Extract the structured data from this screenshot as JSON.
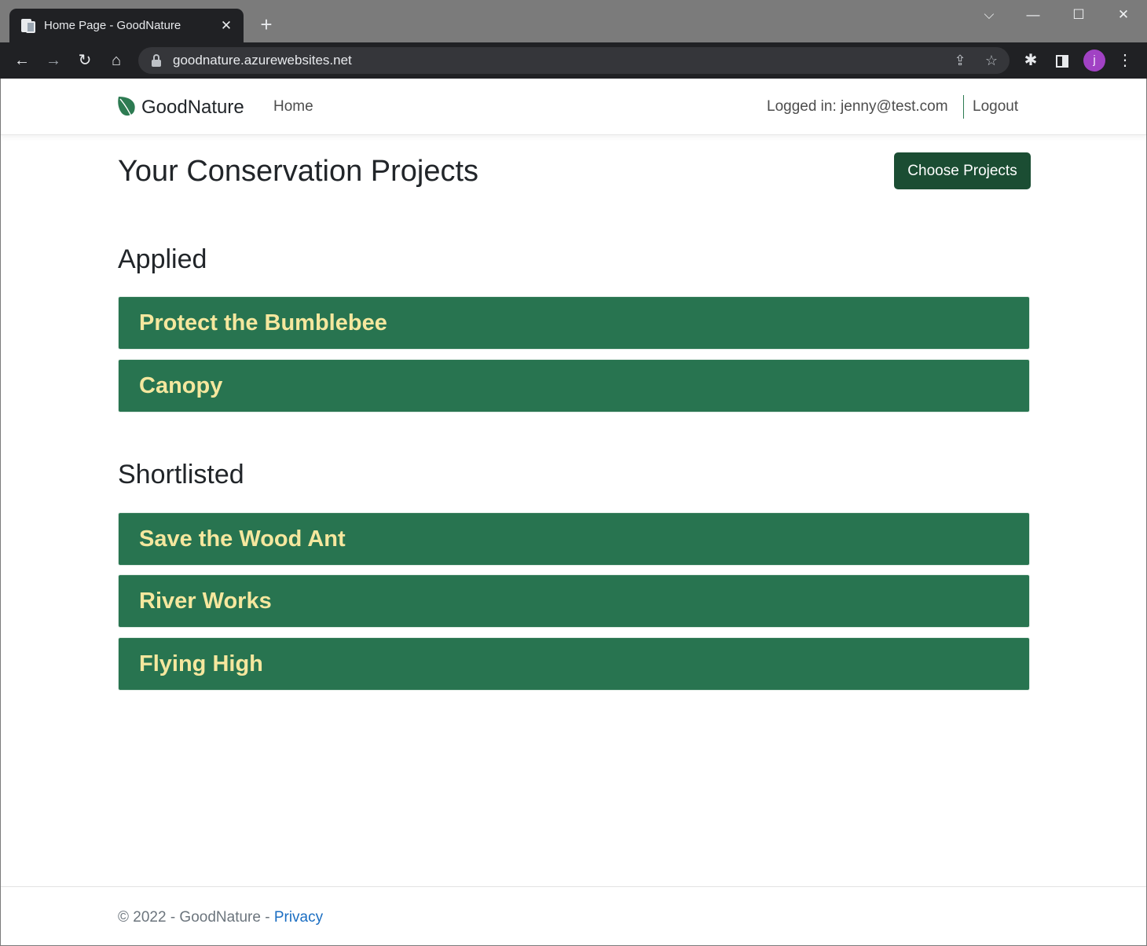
{
  "browser": {
    "tab_title": "Home Page - GoodNature",
    "tab_close": "✕",
    "new_tab": "+",
    "url": "goodnature.azurewebsites.net",
    "window_controls": {
      "tab_search": "⌵",
      "minimize": "—",
      "maximize": "☐",
      "close": "✕"
    },
    "toolbar": {
      "back": "←",
      "forward": "→",
      "reload": "↻",
      "home": "⌂",
      "share": "⇪",
      "bookmark": "☆",
      "extensions": "✱",
      "menu": "⋮"
    },
    "profile_initial": "j",
    "profile_color": "#a142c4"
  },
  "nav": {
    "brand": "GoodNature",
    "home": "Home",
    "logged_in": "Logged in: jenny@test.com",
    "logout": "Logout"
  },
  "main": {
    "title": "Your Conservation Projects",
    "choose_button": "Choose Projects",
    "sections": [
      {
        "heading": "Applied",
        "projects": [
          "Protect the Bumblebee",
          "Canopy"
        ]
      },
      {
        "heading": "Shortlisted",
        "projects": [
          "Save the Wood Ant",
          "River Works",
          "Flying High"
        ]
      }
    ]
  },
  "footer": {
    "text": "© 2022 - GoodNature - ",
    "privacy": "Privacy"
  },
  "colors": {
    "brand_green": "#287450",
    "button_green": "#1b4d33",
    "project_text": "#f5e79e",
    "link_blue": "#1b6ec2"
  }
}
